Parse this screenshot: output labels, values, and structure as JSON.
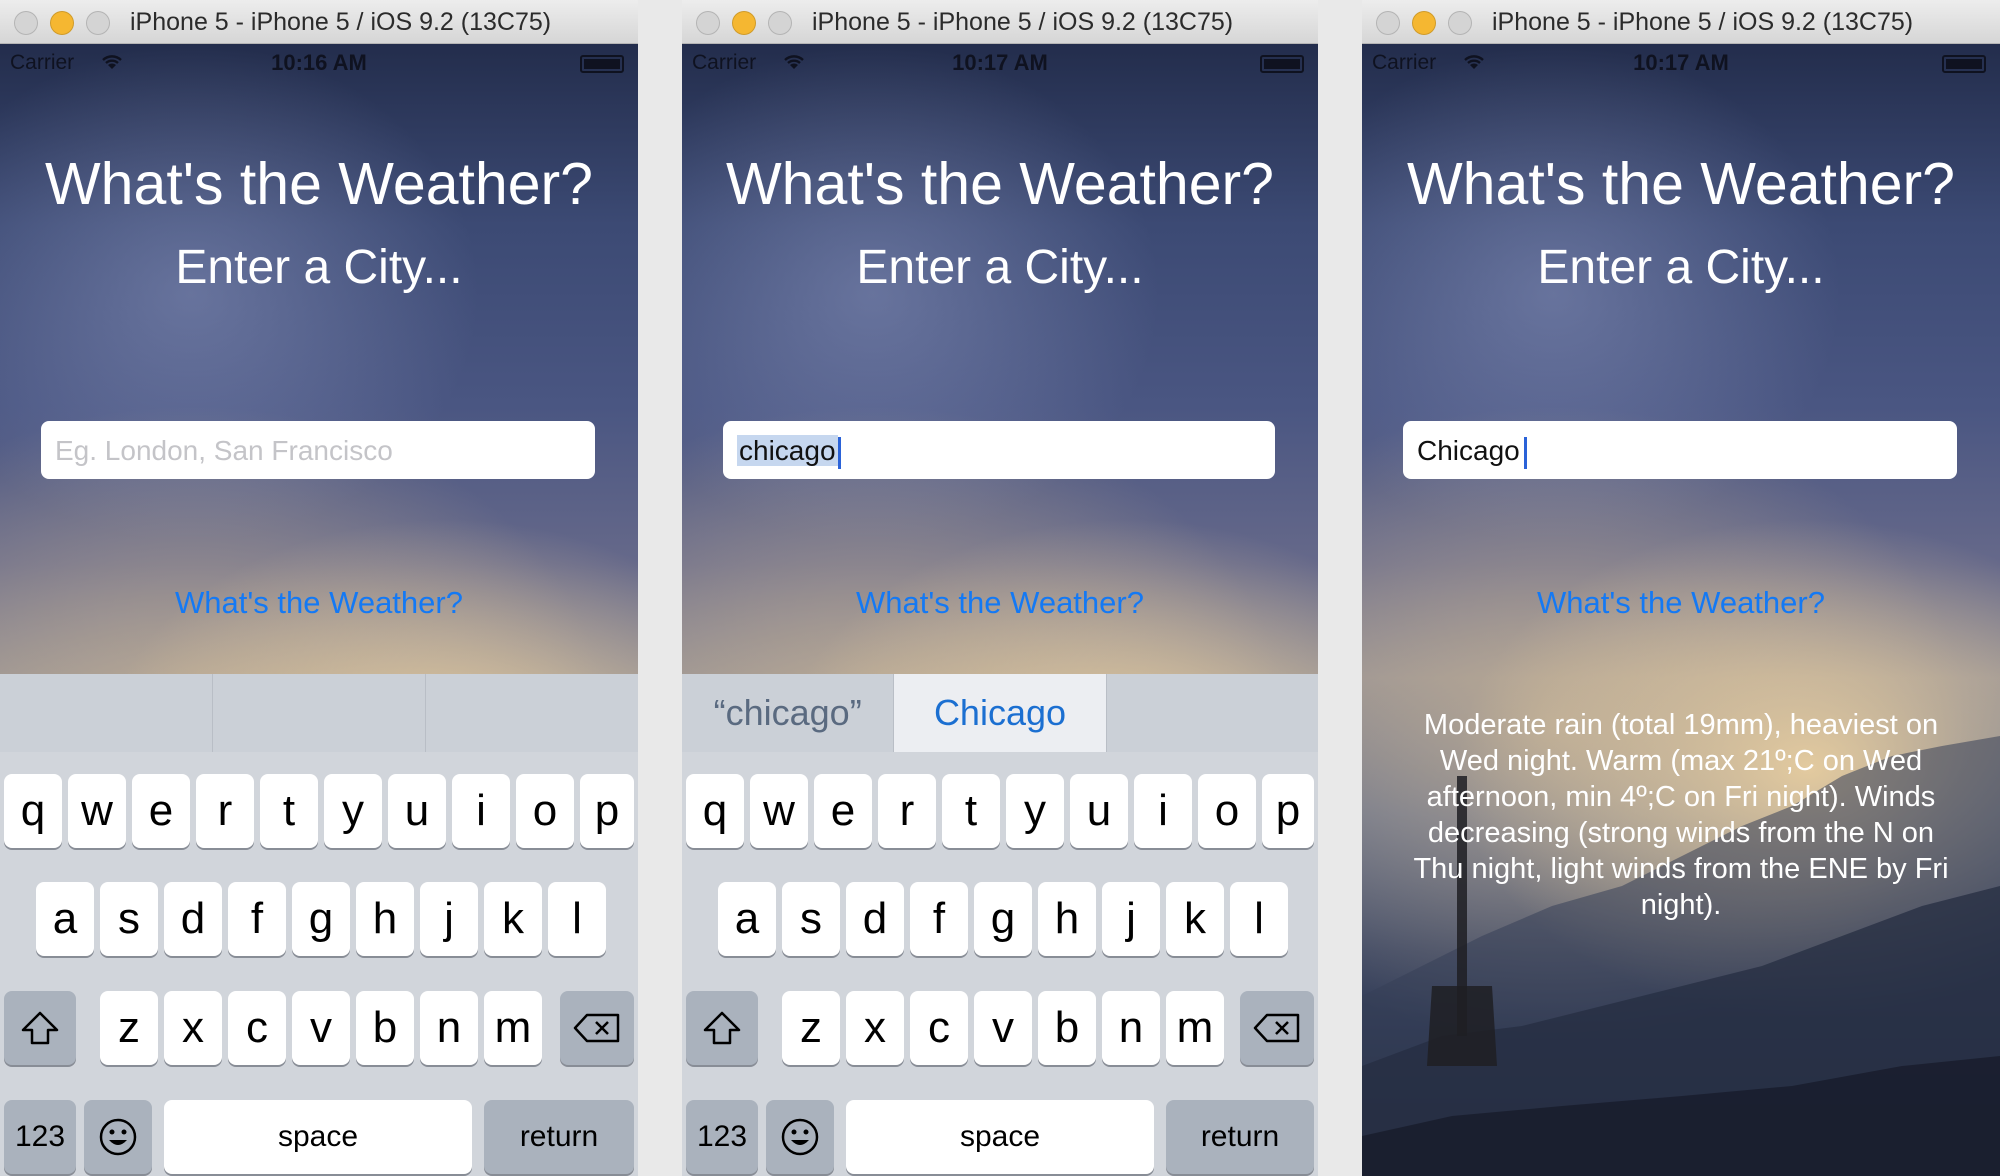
{
  "windows": [
    {
      "title": "iPhone 5 - iPhone 5 / iOS 9.2 (13C75)",
      "status": {
        "carrier": "Carrier",
        "time": "10:16 AM"
      },
      "heading": "What's the Weather?",
      "subheading": "Enter a City...",
      "field": {
        "value": "",
        "placeholder": "Eg. London, San Francisco"
      },
      "button_label": "What's the Weather?",
      "suggestions": [
        "",
        "",
        ""
      ],
      "result": ""
    },
    {
      "title": "iPhone 5 - iPhone 5 / iOS 9.2 (13C75)",
      "status": {
        "carrier": "Carrier",
        "time": "10:17 AM"
      },
      "heading": "What's the Weather?",
      "subheading": "Enter a City...",
      "field": {
        "value": "chicago",
        "placeholder": "Eg. London, San Francisco"
      },
      "button_label": "What's the Weather?",
      "suggestions": [
        "“chicago”",
        "Chicago",
        ""
      ],
      "result": ""
    },
    {
      "title": "iPhone 5 - iPhone 5 / iOS 9.2 (13C75)",
      "status": {
        "carrier": "Carrier",
        "time": "10:17 AM"
      },
      "heading": "What's the Weather?",
      "subheading": "Enter a City...",
      "field": {
        "value": "Chicago",
        "placeholder": "Eg. London, San Francisco"
      },
      "button_label": "What's the Weather?",
      "suggestions": [],
      "result": "Moderate rain (total 19mm), heaviest on Wed night. Warm (max 21º;C on Wed afternoon, min 4º;C on Fri night). Winds decreasing (strong winds from the N on Thu night, light winds from the ENE by Fri night)."
    }
  ],
  "keyboard": {
    "row1": [
      "q",
      "w",
      "e",
      "r",
      "t",
      "y",
      "u",
      "i",
      "o",
      "p"
    ],
    "row2": [
      "a",
      "s",
      "d",
      "f",
      "g",
      "h",
      "j",
      "k",
      "l"
    ],
    "row3": [
      "z",
      "x",
      "c",
      "v",
      "b",
      "n",
      "m"
    ],
    "numbers_label": "123",
    "space_label": "space",
    "return_label": "return"
  },
  "colors": {
    "link": "#1479f4",
    "selection": "#c6d7ef",
    "close": "#d4d4d4",
    "minimize": "#f5b731",
    "zoom": "#d4d4d4"
  }
}
